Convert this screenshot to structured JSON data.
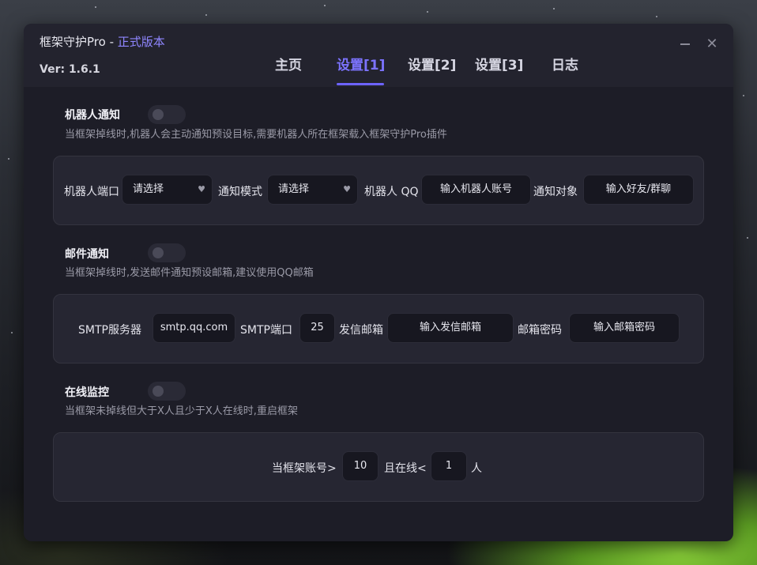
{
  "window": {
    "app_name": "框架守护Pro",
    "separator": " - ",
    "edition": "正式版本",
    "version": "Ver: 1.6.1"
  },
  "tabs": [
    {
      "label": "主页",
      "active": false
    },
    {
      "label": "设置[1]",
      "active": true
    },
    {
      "label": "设置[2]",
      "active": false
    },
    {
      "label": "设置[3]",
      "active": false
    },
    {
      "label": "日志",
      "active": false
    }
  ],
  "robot_notify": {
    "title": "机器人通知",
    "enabled": false,
    "description": "当框架掉线时,机器人会主动通知预设目标,需要机器人所在框架载入框架守护Pro插件",
    "port_label": "机器人端口",
    "port_select": "请选择",
    "mode_label": "通知模式",
    "mode_select": "请选择",
    "qq_label": "机器人 QQ",
    "qq_placeholder": "输入机器人账号",
    "target_label": "通知对象",
    "target_placeholder": "输入好友/群聊"
  },
  "mail_notify": {
    "title": "邮件通知",
    "enabled": false,
    "description": "当框架掉线时,发送邮件通知预设邮箱,建议使用QQ邮箱",
    "smtp_label": "SMTP服务器",
    "smtp_value": "smtp.qq.com",
    "port_label": "SMTP端口",
    "port_value": "25",
    "sender_label": "发信邮箱",
    "sender_placeholder": "输入发信邮箱",
    "password_label": "邮箱密码",
    "password_placeholder": "输入邮箱密码"
  },
  "online_monitor": {
    "title": "在线监控",
    "enabled": false,
    "description": "当框架未掉线但大于X人且少于X人在线时,重启框架",
    "accounts_label": "当框架账号>",
    "accounts_value": "10",
    "online_label": "且在线<",
    "online_value": "1",
    "unit": "人"
  },
  "colors": {
    "accent": "#7c73ff",
    "panel": "#262632",
    "window": "#1d1d27"
  }
}
